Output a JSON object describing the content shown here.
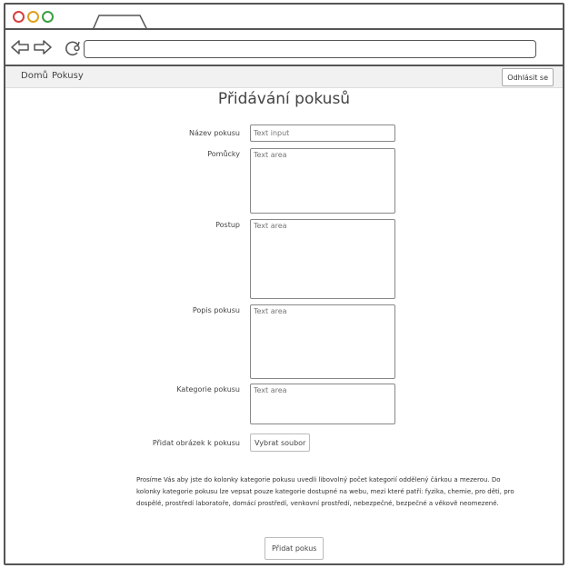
{
  "browser": {
    "url": ""
  },
  "nav": {
    "home": "Domů",
    "experiments": "Pokusy",
    "logout": "Odhlásit se"
  },
  "page": {
    "title": "Přidávání pokusů"
  },
  "form": {
    "name_label": "Název pokusu",
    "name_placeholder": "Text input",
    "tools_label": "Pomůcky",
    "tools_placeholder": "Text area",
    "procedure_label": "Postup",
    "procedure_placeholder": "Text area",
    "description_label": "Popis pokusu",
    "description_placeholder": "Text area",
    "category_label": "Kategorie pokusu",
    "category_placeholder": "Text area",
    "image_label": "Přidat obrázek k pokusu",
    "file_button": "Vybrat soubor",
    "note": "Prosíme Vás aby jste do kolonky kategorie pokusu uvedli libovolný počet kategorií oddělený čárkou a mezerou. Do kolonky kategorie pokusu lze vepsat pouze kategorie dostupné na webu, mezi které patří: fyzika, chemie, pro děti, pro dospělé, prostředí laboratoře, domácí prostředí, venkovní prostředí, nebezpečné, bezpečné a věkově neomezené.",
    "submit": "Přidat pokus"
  }
}
